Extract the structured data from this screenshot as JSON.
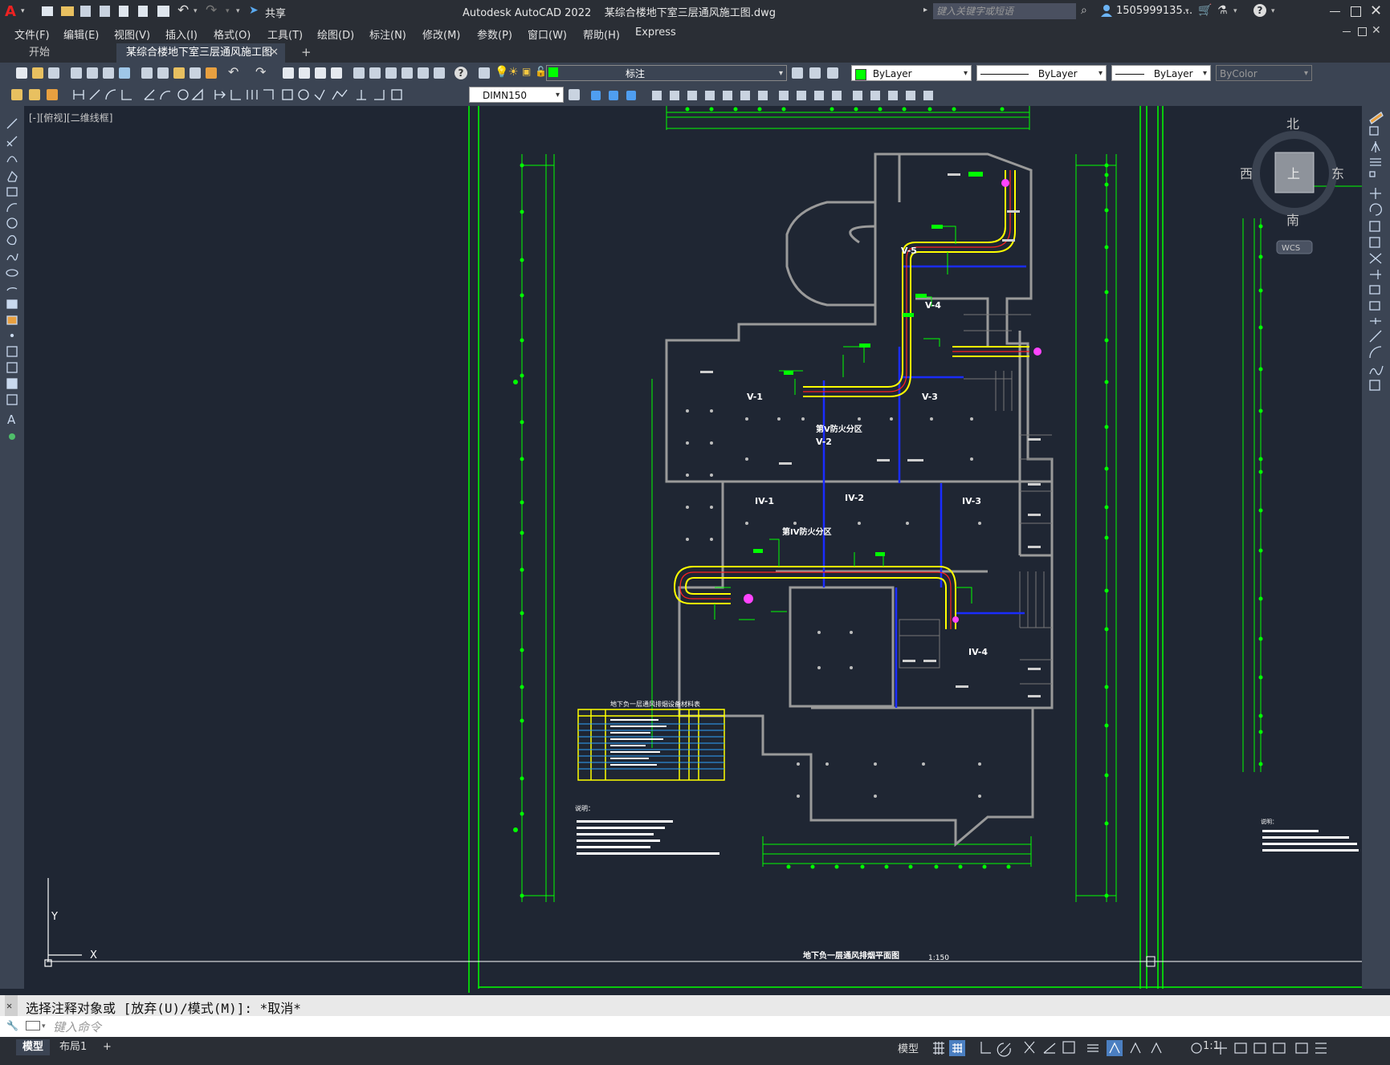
{
  "app": {
    "title": "Autodesk AutoCAD 2022    某综合楼地下室三层通风施工图.dwg",
    "share_label": "共享",
    "search_placeholder": "键入关键字或短语",
    "user": "1505999135...",
    "window_controls": [
      "minimize-icon",
      "maximize-icon",
      "close-icon"
    ]
  },
  "menu": {
    "items": [
      "文件(F)",
      "编辑(E)",
      "视图(V)",
      "插入(I)",
      "格式(O)",
      "工具(T)",
      "绘图(D)",
      "标注(N)",
      "修改(M)",
      "参数(P)",
      "窗口(W)",
      "帮助(H)",
      "Express"
    ]
  },
  "tabs": {
    "start": "开始",
    "active": "某综合楼地下室三层通风施工图*",
    "add": "+"
  },
  "toolbar": {
    "layer": "标注",
    "color": "ByLayer",
    "linetype": "ByLayer",
    "lineweight": "ByLayer",
    "plotstyle": "ByColor",
    "dimstyle": "DIMN150"
  },
  "viewport": {
    "label": "[-][俯视][二维线框]",
    "compass": {
      "north": "北",
      "south": "南",
      "east": "东",
      "west": "西",
      "top": "上",
      "wcs": "WCS"
    },
    "ucs": {
      "x": "X",
      "y": "Y"
    }
  },
  "drawing": {
    "zones": [
      "V-5",
      "V-4",
      "V-1",
      "V-3",
      "V-2",
      "IV-1",
      "IV-2",
      "IV-3",
      "IV-4"
    ],
    "fire_zone_v": "第V防火分区",
    "fire_zone_iv": "第IV防火分区",
    "plan_title": "地下负一层通风排烟平面图",
    "scale": "1:150",
    "table_title": "地下负一层通风排烟设备材料表",
    "notes_label": "说明："
  },
  "command": {
    "history": "选择注释对象或 [放弃(U)/模式(M)]: *取消*",
    "placeholder": "键入命令"
  },
  "status": {
    "layout_tabs": [
      "模型",
      "布局1",
      "+"
    ],
    "model_label": "模型",
    "scale_label": "1:1"
  },
  "colors": {
    "background": "#1f2633",
    "chrome": "#2a2e35",
    "toolbar": "#3b4453",
    "accent_green": "#00ff00",
    "duct_yellow": "#ffff00",
    "wall_gray": "#9a9a9a",
    "blue_line": "#0000ff"
  }
}
